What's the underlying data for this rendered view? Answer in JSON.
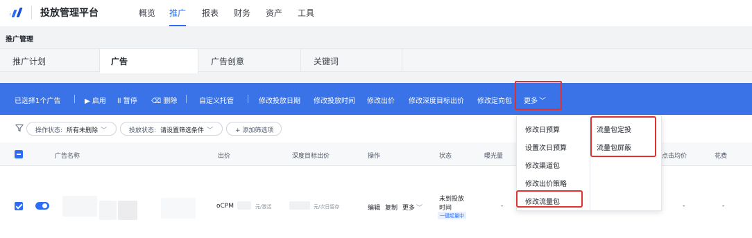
{
  "app": {
    "title": "投放管理平台"
  },
  "nav": [
    "概览",
    "推广",
    "报表",
    "财务",
    "资产",
    "工具"
  ],
  "page": {
    "heading": "推广管理"
  },
  "tabs": [
    "推广计划",
    "广告",
    "广告创意",
    "关键词"
  ],
  "actions": {
    "selected": "已选择1个广告",
    "enable": "▶ 启用",
    "pause": "ll 暂停",
    "delete": "⌫ 删除",
    "custom": "自定义托管",
    "edit_date": "修改投放日期",
    "edit_time": "修改投放时间",
    "edit_bid": "修改出价",
    "edit_deep_bid": "修改深度目标出价",
    "edit_target": "修改定向包",
    "more": "更多"
  },
  "filters": [
    {
      "label": "操作状态:",
      "value": "所有未删除"
    },
    {
      "label": "投放状态:",
      "value": "请设置筛选条件"
    },
    {
      "label": "+ 添加筛选项"
    }
  ],
  "table": {
    "headers": [
      "广告名称",
      "出价",
      "深度目标出价",
      "操作",
      "状态",
      "曝光量",
      "点击均价",
      "花费"
    ],
    "row": {
      "bid": "oCPM",
      "bid_unit": "元/激活",
      "deep_bid_unit": "元/次日留存",
      "ops": [
        "编辑",
        "复制",
        "更多"
      ],
      "status": [
        "未到投放",
        "时间"
      ],
      "status_tag": "一键起量中",
      "impressions": "-",
      "avg_click": "-",
      "cost": "-"
    }
  },
  "menu": {
    "left": [
      "修改日预算",
      "设置次日预算",
      "修改渠道包",
      "修改出价策略",
      "修改流量包"
    ],
    "right": [
      "流量包定投",
      "流量包屏蔽"
    ]
  },
  "colors": {
    "accent": "#2d6df6",
    "action_bar": "#3a73e8",
    "highlight": "#e0302f"
  }
}
